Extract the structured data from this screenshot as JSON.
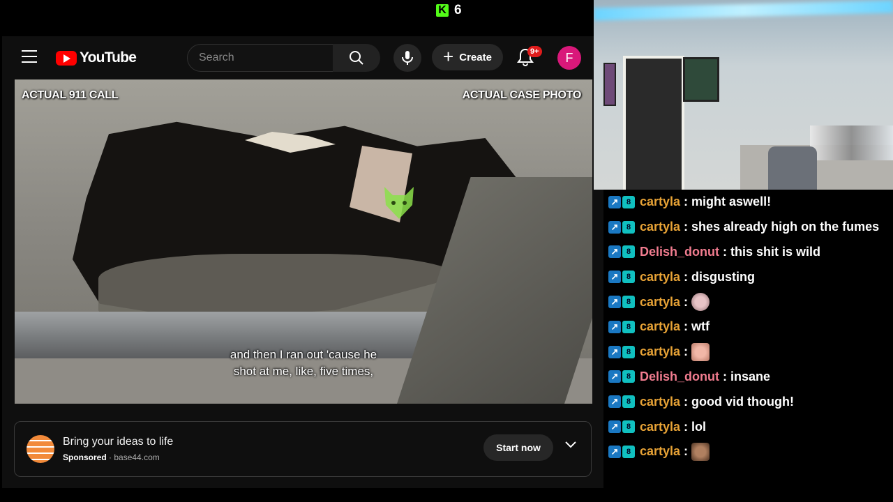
{
  "kick": {
    "count": "6",
    "logo_letter": "K"
  },
  "youtube": {
    "logo_text": "YouTube",
    "search_placeholder": "Search",
    "create_label": "Create",
    "notifications_badge": "9+",
    "avatar_letter": "F"
  },
  "video": {
    "left_label": "ACTUAL 911 CALL",
    "right_label": "ACTUAL CASE PHOTO",
    "caption_line1": "and then I ran out 'cause he",
    "caption_line2": "shot at me, like, five times,"
  },
  "ad": {
    "title": "Bring your ideas to life",
    "sponsored": "Sponsored",
    "domain": "base44.com",
    "cta": "Start now"
  },
  "chat": [
    {
      "user": "cartyla",
      "user_color": "#e8a336",
      "message": "might aswell!"
    },
    {
      "user": "cartyla",
      "user_color": "#e8a336",
      "message": "shes already high on the fumes"
    },
    {
      "user": "Delish_donut",
      "user_color": "#f17c8f",
      "message": "this shit is wild"
    },
    {
      "user": "cartyla",
      "user_color": "#e8a336",
      "message": "disgusting"
    },
    {
      "user": "cartyla",
      "user_color": "#e8a336",
      "message": "",
      "emote": "cat-emote"
    },
    {
      "user": "cartyla",
      "user_color": "#e8a336",
      "message": "wtf"
    },
    {
      "user": "cartyla",
      "user_color": "#e8a336",
      "message": "",
      "emote": "face-emote"
    },
    {
      "user": "Delish_donut",
      "user_color": "#f17c8f",
      "message": "insane"
    },
    {
      "user": "cartyla",
      "user_color": "#e8a336",
      "message": "good vid though!"
    },
    {
      "user": "cartyla",
      "user_color": "#e8a336",
      "message": "lol"
    },
    {
      "user": "cartyla",
      "user_color": "#e8a336",
      "message": "",
      "emote": "hat-emote"
    }
  ],
  "chat_separator": ":"
}
